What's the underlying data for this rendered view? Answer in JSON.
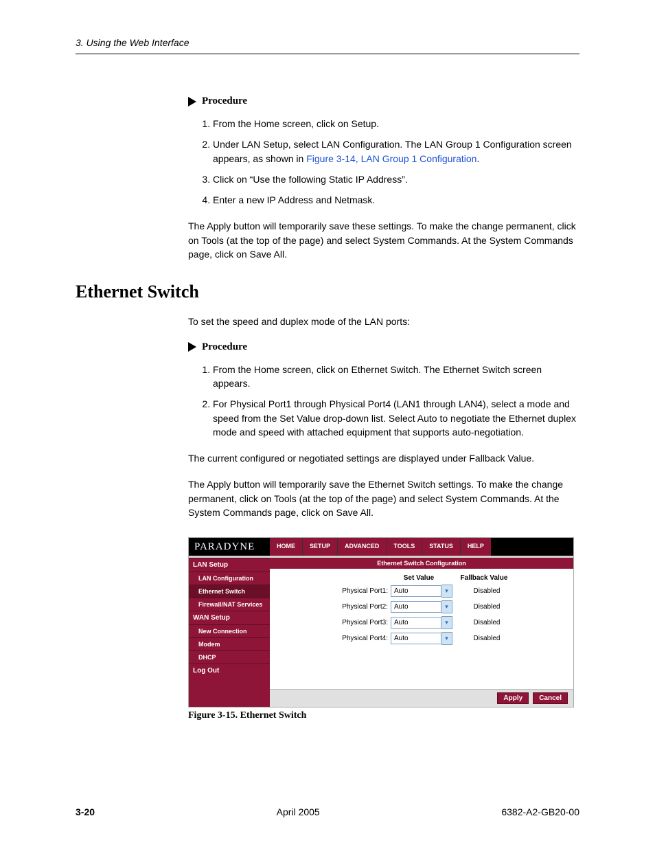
{
  "page": {
    "running_head": "3. Using the Web Interface",
    "section_title": "Ethernet Switch",
    "intro_section_para": "To set the speed and duplex mode of the LAN ports:",
    "fig_caption": "Figure 3-15.   Ethernet Switch"
  },
  "proc1": {
    "label": "Procedure",
    "steps": [
      "From the Home screen, click on Setup.",
      "Under LAN Setup, select LAN Configuration. The LAN Group 1 Configuration screen appears, as shown in ",
      "Click on “Use the following Static IP Address”.",
      "Enter a new IP Address and Netmask."
    ],
    "step2_link": "Figure 3-14, LAN Group 1 Configuration",
    "after": "The Apply button will temporarily save these settings. To make the change permanent, click on Tools (at the top of the page) and select System Commands. At the System Commands page, click on Save All."
  },
  "proc2": {
    "label": "Procedure",
    "steps": [
      "From the Home screen, click on Ethernet Switch. The Ethernet Switch screen appears.",
      "For Physical Port1 through Physical Port4 (LAN1 through LAN4), select a mode and speed from the Set Value drop-down list. Select Auto to negotiate the Ethernet duplex mode and speed with attached equipment that supports auto-negotiation."
    ],
    "after1": "The current configured or negotiated settings are displayed under Fallback Value.",
    "after2": "The Apply button will temporarily save the Ethernet Switch settings. To make the change permanent, click on Tools (at the top of the page) and select System Commands. At the System Commands page, click on Save All."
  },
  "ui": {
    "logo": "PARADYNE",
    "nav": [
      "HOME",
      "SETUP",
      "ADVANCED",
      "TOOLS",
      "STATUS",
      "HELP"
    ],
    "sidebar": {
      "groups": [
        {
          "head": "LAN Setup",
          "items": [
            "LAN Configuration",
            "Ethernet Switch",
            "Firewall/NAT Services"
          ]
        },
        {
          "head": "WAN Setup",
          "items": [
            "New Connection",
            "Modem",
            "DHCP"
          ]
        },
        {
          "head": "Log Out",
          "items": []
        }
      ],
      "active": "Ethernet Switch"
    },
    "panel_title": "Ethernet Switch Configuration",
    "col_set": "Set Value",
    "col_fb": "Fallback Value",
    "rows": [
      {
        "label": "Physical Port1:",
        "value": "Auto",
        "fallback": "Disabled"
      },
      {
        "label": "Physical Port2:",
        "value": "Auto",
        "fallback": "Disabled"
      },
      {
        "label": "Physical Port3:",
        "value": "Auto",
        "fallback": "Disabled"
      },
      {
        "label": "Physical Port4:",
        "value": "Auto",
        "fallback": "Disabled"
      }
    ],
    "buttons": {
      "apply": "Apply",
      "cancel": "Cancel"
    }
  },
  "footer": {
    "pagenum": "3-20",
    "date": "April 2005",
    "docid": "6382-A2-GB20-00"
  }
}
